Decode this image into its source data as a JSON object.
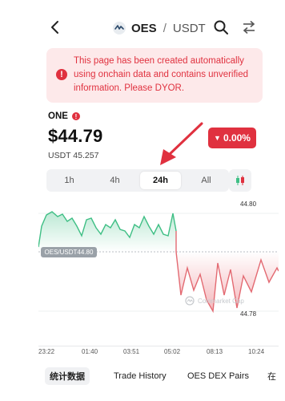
{
  "header": {
    "base_symbol": "OES",
    "separator": "/",
    "quote_symbol": "USDT"
  },
  "warning": {
    "text": "This page has been created automatically using onchain data and contains unverified information. Please DYOR.",
    "icon": "alert-circle-icon"
  },
  "token": {
    "name": "ONE",
    "price": "$44.79",
    "sub_price": "USDT 45.257",
    "change": "0.00%"
  },
  "timeframes": {
    "items": [
      "1h",
      "4h",
      "24h",
      "All"
    ],
    "active": "24h"
  },
  "chart": {
    "high_label": "44.80",
    "low_label": "44.78",
    "price_tag": "OES/USDT44.80",
    "watermark": "Coinmarket Cap",
    "up_color": "#3fbf85",
    "down_color": "#e0313f",
    "time_labels": [
      "23:22",
      "01:40",
      "03:51",
      "05:02",
      "08:13",
      "10:24"
    ]
  },
  "bottom_tabs": {
    "items": [
      "统计数据",
      "Trade History",
      "OES DEX Pairs",
      "在"
    ],
    "active": "统计数据"
  },
  "colors": {
    "accent_red": "#e0313f",
    "warning_bg": "#fde9ea"
  }
}
